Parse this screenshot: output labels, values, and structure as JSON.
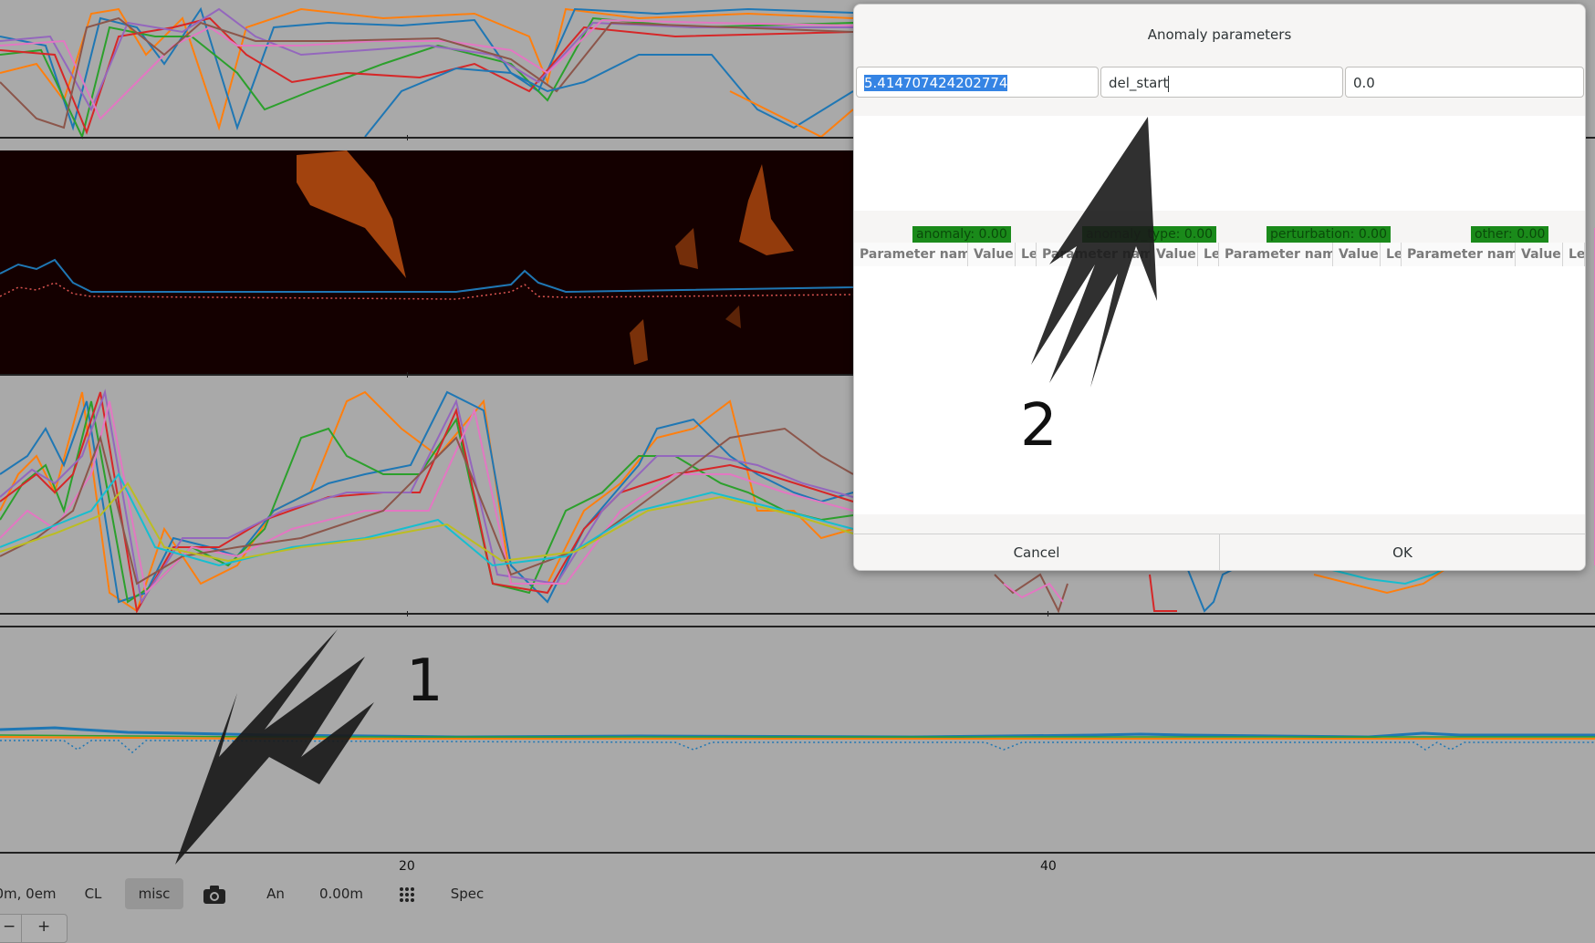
{
  "plot": {
    "x_ticks": [
      "20",
      "40"
    ]
  },
  "annotations": {
    "label1": "1",
    "label2": "2"
  },
  "toolbar": {
    "position_label": "0m, 0em",
    "cl_label": "CL",
    "misc_label": "misc",
    "camera_icon": "camera-icon",
    "an_label": "An",
    "offset_value": "0.00m",
    "grid_icon": "grid-dots-icon",
    "spec_label": "Spec",
    "zoom_out": "−",
    "zoom_in": "+"
  },
  "dialog": {
    "title": "Anomaly parameters",
    "field1_value": "5.414707424202774",
    "field2_value": "del_start",
    "field3_value": "0.0",
    "badges": [
      "anomaly: 0.00",
      "anomaly_type: 0.00",
      "perturbation: 0.00",
      "other: 0.00"
    ],
    "column_headers": [
      "Parameter name",
      "Value",
      "Le"
    ],
    "cancel_label": "Cancel",
    "ok_label": "OK"
  },
  "colors": {
    "background": "#a9a9a9",
    "heatmap_bg": "#140000",
    "selection": "#3584e4",
    "badge_green": "#1a8a1a"
  }
}
